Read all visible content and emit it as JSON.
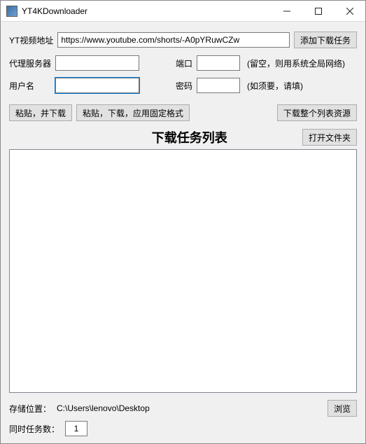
{
  "window": {
    "title": "YT4KDownloader"
  },
  "form": {
    "url_label": "YT视频地址",
    "url_value": "https://www.youtube.com/shorts/-A0pYRuwCZw",
    "add_task_btn": "添加下载任务",
    "proxy_label": "代理服务器",
    "proxy_value": "",
    "port_label": "端口",
    "port_value": "",
    "proxy_hint": "(留空，则用系统全局网络)",
    "user_label": "用户名",
    "user_value": "",
    "pass_label": "密码",
    "pass_value": "",
    "cred_hint": "(如须要，请填)"
  },
  "buttons": {
    "paste_download": "粘贴，并下载",
    "paste_download_fixed": "粘贴，下载，应用固定格式",
    "download_playlist": "下载整个列表资源",
    "open_folder": "打开文件夹",
    "browse": "浏览"
  },
  "list": {
    "title": "下载任务列表"
  },
  "footer": {
    "storage_label": "存储位置：",
    "storage_path": "C:\\Users\\lenovo\\Desktop",
    "concurrent_label": "同时任务数：",
    "concurrent_value": "1"
  }
}
